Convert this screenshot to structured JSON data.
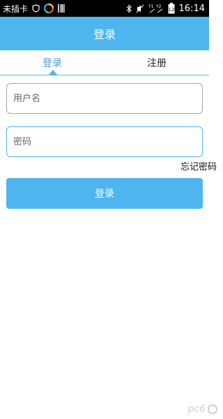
{
  "status_bar": {
    "carrier": "未插卡",
    "time": "16:14",
    "battery": "12",
    "icons": [
      "shield-icon",
      "app-logo-icon",
      "barcode-icon",
      "bluetooth-icon",
      "mute-icon",
      "signal-icon",
      "battery-icon"
    ]
  },
  "app_bar": {
    "title": "登录"
  },
  "tabs": [
    {
      "label": "登录",
      "active": true
    },
    {
      "label": "注册",
      "active": false
    }
  ],
  "form": {
    "username_placeholder": "用户名",
    "password_placeholder": "密码",
    "forgot_password": "忘记密码",
    "login_button": "登录"
  },
  "watermark": "pc6",
  "colors": {
    "accent": "#4fb5ef",
    "active_tab_text": "#3fa0d8"
  }
}
